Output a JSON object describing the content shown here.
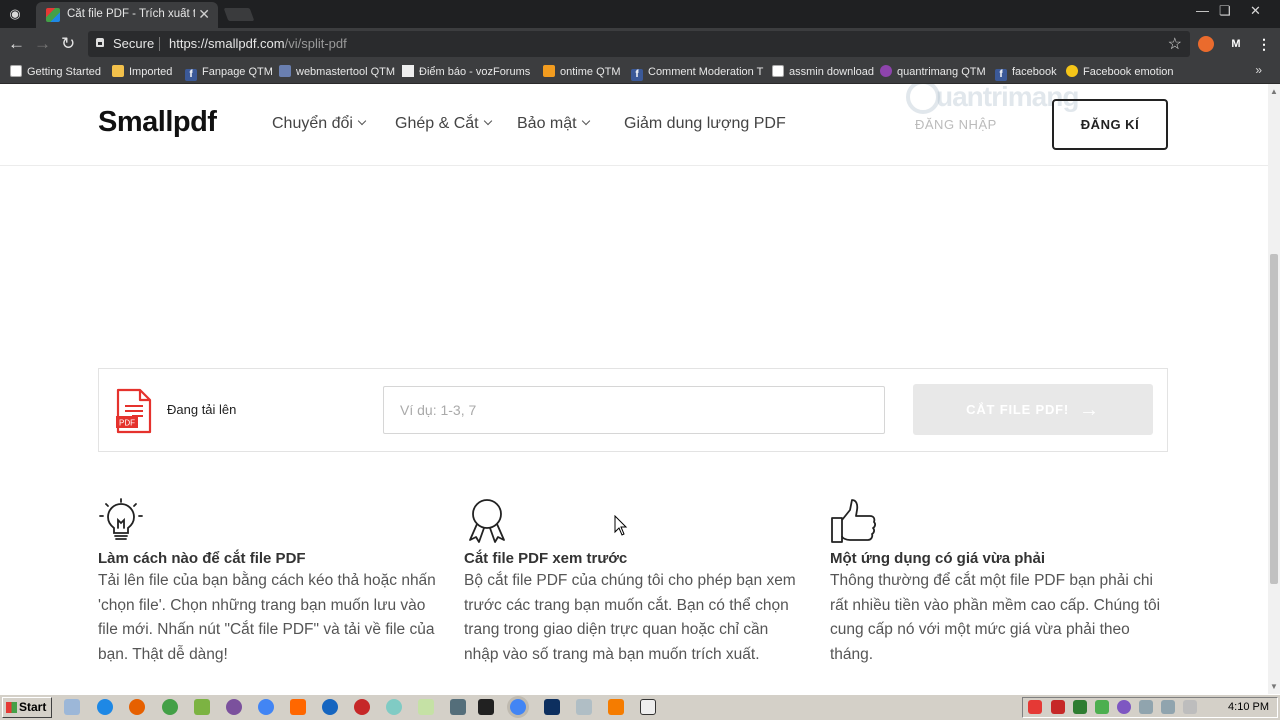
{
  "browser": {
    "tab_title": "Cắt file PDF - Trích xuất tr",
    "secure_label": "Secure",
    "url_main": "https://smallpdf.com",
    "url_path": "/vi/split-pdf",
    "bookmarks": [
      {
        "label": "Getting Started",
        "icon": "doc"
      },
      {
        "label": "Imported",
        "icon": "folder"
      },
      {
        "label": "Fanpage QTM",
        "icon": "fb"
      },
      {
        "label": "webmastertool QTM",
        "icon": "webmaster"
      },
      {
        "label": "Điểm báo - vozForums",
        "icon": "voz"
      },
      {
        "label": "ontime QTM",
        "icon": "chart"
      },
      {
        "label": "Comment Moderation T",
        "icon": "fb"
      },
      {
        "label": "assmin download",
        "icon": "doc"
      },
      {
        "label": "quantrimang QTM",
        "icon": "quantrimang"
      },
      {
        "label": "facebook",
        "icon": "fb"
      },
      {
        "label": "Facebook emotion",
        "icon": "emoji"
      }
    ]
  },
  "header": {
    "logo": "Smallpdf",
    "nav": [
      {
        "label": "Chuyển đổi",
        "has_dropdown": true
      },
      {
        "label": "Ghép & Cắt",
        "has_dropdown": true
      },
      {
        "label": "Bảo mật",
        "has_dropdown": true
      },
      {
        "label": "Giảm dung lượng PDF",
        "has_dropdown": false
      }
    ],
    "login_label": "ĐĂNG NHẬP",
    "signup_label": "ĐĂNG KÍ",
    "watermark": "uantrimang"
  },
  "upload": {
    "status": "Đang tải lên",
    "pdf_badge": "PDF",
    "range_placeholder": "Ví dụ: 1-3, 7",
    "range_value": "",
    "split_button": "CẮT FILE PDF!",
    "split_disabled": true
  },
  "features": [
    {
      "icon": "lightbulb-icon",
      "title": "Làm cách nào để cắt file PDF",
      "text": "Tải lên file của bạn bằng cách kéo thả hoặc nhấn 'chọn file'. Chọn những trang bạn muốn lưu vào file mới. Nhấn nút \"Cắt file PDF\" và tải về file của bạn. Thật dễ dàng!"
    },
    {
      "icon": "award-ribbon-icon",
      "title": "Cắt file PDF xem trước",
      "text": "Bộ cắt file PDF của chúng tôi cho phép bạn xem trước các trang bạn muốn cắt. Bạn có thể chọn trang trong giao diện trực quan hoặc chỉ cần nhập vào số trang mà bạn muốn trích xuất."
    },
    {
      "icon": "thumbs-up-icon",
      "title": "Một ứng dụng có giá vừa phải",
      "text": "Thông thường để cắt một file PDF bạn phải chi rất nhiều tiền vào phần mềm cao cấp. Chúng tôi cung cấp nó với một mức giá vừa phải theo tháng."
    }
  ],
  "taskbar": {
    "start_label": "Start",
    "clock": "4:10 PM"
  }
}
